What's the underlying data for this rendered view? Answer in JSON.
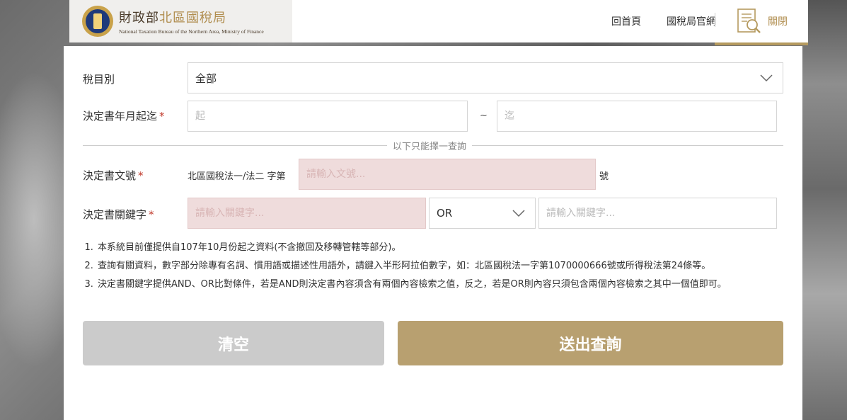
{
  "header": {
    "logo_cn_main": "財政部",
    "logo_cn_accent": "北區國稅局",
    "logo_en": "National Taxation Bureau of the Northern Area, Ministry of Finance",
    "nav": [
      {
        "label": "回首頁"
      },
      {
        "label": "國稅局官網"
      }
    ],
    "close_label": "關閉"
  },
  "form": {
    "tax_category": {
      "label": "稅目別",
      "value": "全部"
    },
    "date_range": {
      "label": "決定書年月起迄",
      "required_mark": "*",
      "start_placeholder": "起",
      "end_placeholder": "迄",
      "separator": "~"
    },
    "divider_text": "以下只能擇一查詢",
    "doc_number": {
      "label": "決定書文號",
      "required_mark": "*",
      "prefix": "北區國稅法一/法二 字第",
      "placeholder": "請輸入文號...",
      "suffix": "號"
    },
    "keyword": {
      "label": "決定書關鍵字",
      "required_mark": "*",
      "placeholder1": "請輸入關鍵字...",
      "operator": "OR",
      "placeholder2": "請輸入關鍵字..."
    }
  },
  "notes": [
    "本系統目前僅提供自107年10月份起之資料(不含撤回及移轉管轄等部分)。",
    "查詢有關資料，數字部分除專有名詞、慣用語或描述性用語外，請鍵入半形阿拉伯數字，如：北區國稅法一字第1070000666號或所得稅法第24條等。",
    "決定書關鍵字提供AND、OR比對條件，若是AND則決定書內容須含有兩個內容檢索之值，反之，若是OR則內容只須包含兩個內容檢索之其中一個值即可。"
  ],
  "buttons": {
    "clear": "清空",
    "submit": "送出查詢"
  },
  "colors": {
    "accent_gold": "#b8a070",
    "required_red": "#c0392b",
    "pink_input": "#efdcdc"
  }
}
